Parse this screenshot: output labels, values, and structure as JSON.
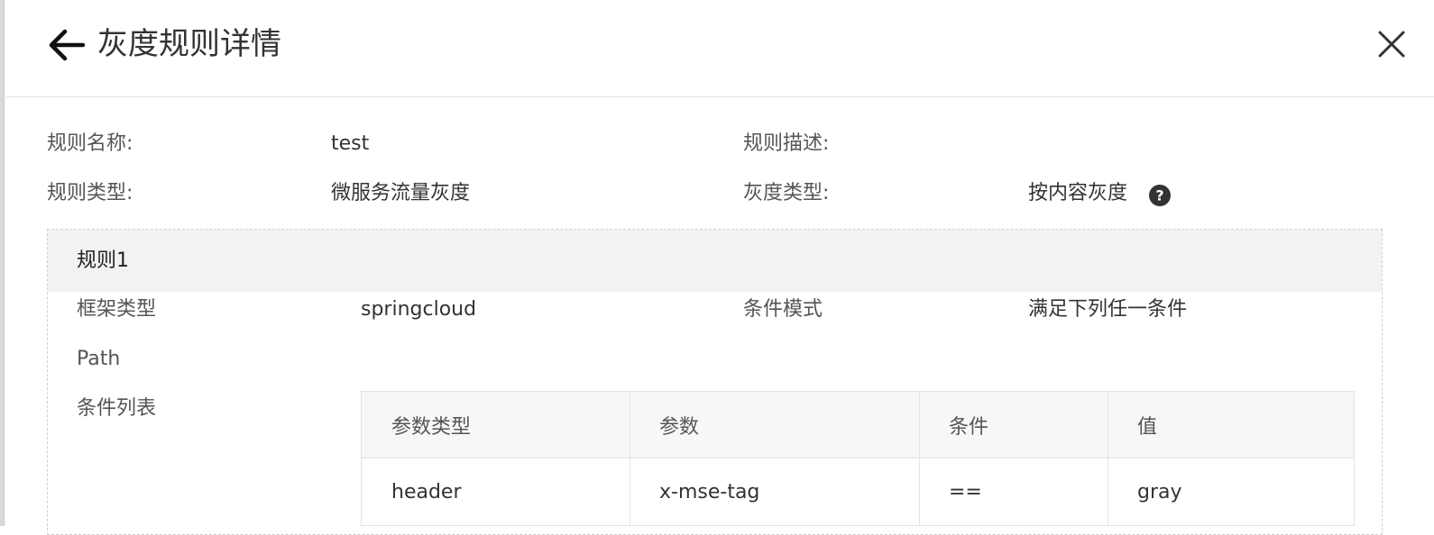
{
  "header": {
    "title": "灰度规则详情",
    "back_icon": "arrow-left-icon",
    "close_icon": "close-icon"
  },
  "info": {
    "rule_name_label": "规则名称:",
    "rule_name_value": "test",
    "rule_desc_label": "规则描述:",
    "rule_desc_value": "",
    "rule_type_label": "规则类型:",
    "rule_type_value": "微服务流量灰度",
    "gray_type_label": "灰度类型:",
    "gray_type_value": "按内容灰度",
    "help_icon": "question-circle-icon"
  },
  "rule": {
    "title": "规则1",
    "framework_label": "框架类型",
    "framework_value": "springcloud",
    "cond_mode_label": "条件模式",
    "cond_mode_value": "满足下列任一条件",
    "path_label": "Path",
    "path_value": "",
    "cond_list_label": "条件列表",
    "table": {
      "headers": [
        "参数类型",
        "参数",
        "条件",
        "值"
      ],
      "rows": [
        [
          "header",
          "x-mse-tag",
          "==",
          "gray"
        ]
      ]
    }
  },
  "colors": {
    "card_header_bg": "#f2f2f2",
    "help_icon": "#333333"
  }
}
